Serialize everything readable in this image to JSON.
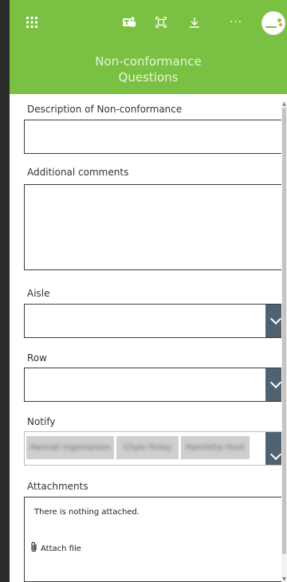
{
  "header": {
    "icons": [
      "app-launcher-icon",
      "teams-icon",
      "expand-icon",
      "download-icon",
      "more-icon"
    ],
    "more_glyph": "···",
    "brand_color": "#7ac143"
  },
  "form": {
    "title_line1": "Non-conformance",
    "title_line2": "Questions",
    "required_marker": "*",
    "description_label": "Description of Non-conformance",
    "description_value": "",
    "comments_label": "Additional comments",
    "comments_value": "",
    "aisle_label": "Aisle",
    "aisle_value": "",
    "row_label": "Row",
    "row_value": "",
    "notify_label": "Notify",
    "notify_people": [
      "Hannah Ingemarsen",
      "Chyle Finlay",
      "Hanrietta Hunt"
    ],
    "attachments_label": "Attachments",
    "attachments_empty": "There is nothing attached.",
    "attach_file": "Attach file",
    "dropdown_color": "#50626f"
  }
}
